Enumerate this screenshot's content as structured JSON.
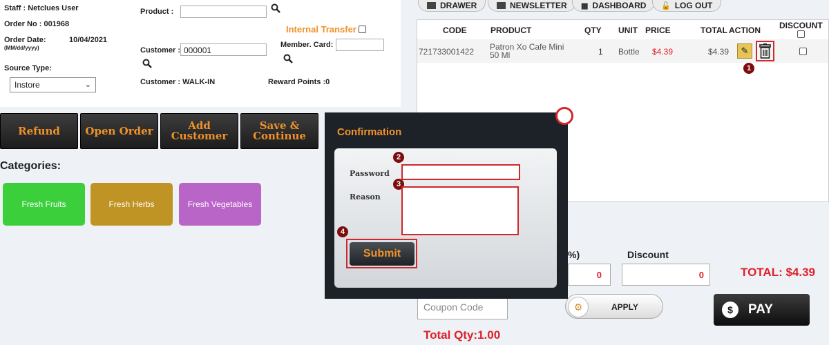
{
  "order": {
    "staff": "Staff : Netclues User",
    "order_no": "Order No : 001968",
    "order_date_label": "Order Date:",
    "order_date_format": "(MM/dd/yyyy)",
    "order_date": "10/04/2021",
    "source_type_label": "Source Type:",
    "source_type_value": "Instore",
    "product_label": "Product :",
    "product_value": "",
    "internal_transfer": "Internal Transfer",
    "customer_label": "Customer :",
    "customer_value": "000001",
    "member_card_label": "Member. Card:",
    "member_card_value": "",
    "customer_name": "Customer : WALK-IN",
    "reward_points": "Reward Points :0"
  },
  "actions": [
    {
      "label": "Refund"
    },
    {
      "label": "Open Order"
    },
    {
      "label": "Add Customer"
    },
    {
      "label": "Save & Continue"
    }
  ],
  "categories_title": "Categories:",
  "categories": [
    {
      "label": "Fresh Fruits",
      "color": "#3ccf3c"
    },
    {
      "label": "Fresh Herbs",
      "color": "#bf9424"
    },
    {
      "label": "Fresh Vegetables",
      "color": "#b964c7"
    }
  ],
  "top_tabs": [
    {
      "label": "DRAWER"
    },
    {
      "label": "NEWSLETTER"
    },
    {
      "label": "DASHBOARD"
    },
    {
      "label": "LOG OUT"
    }
  ],
  "cart": {
    "headers": {
      "code": "CODE",
      "product": "PRODUCT",
      "qty": "QTY",
      "unit": "UNIT",
      "price": "PRICE",
      "total": "TOTAL",
      "action": "ACTION",
      "discount": "DISCOUNT"
    },
    "rows": [
      {
        "code": "721733001422",
        "product": "Patron Xo Cafe Mini 50 Ml",
        "qty": "1",
        "unit": "Bottle",
        "price": "$4.39",
        "total": "$4.39"
      }
    ]
  },
  "modal": {
    "title": "Confirmation",
    "password_label": "Password",
    "reason_label": "Reason",
    "submit_label": "Submit",
    "badges": [
      "1",
      "2",
      "3",
      "4"
    ]
  },
  "footer": {
    "pct_label": "%)",
    "pct_value": "0",
    "discount_label": "Discount",
    "discount_value": "0",
    "total": "TOTAL: $4.39",
    "coupon_placeholder": "Coupon Code",
    "apply_label": "APPLY",
    "pay_label": "PAY",
    "total_qty": "Total Qty:1.00"
  },
  "colors": {
    "accent_orange": "#f0922b",
    "total_red": "#e0202a",
    "annotation_red": "#d0272b"
  }
}
